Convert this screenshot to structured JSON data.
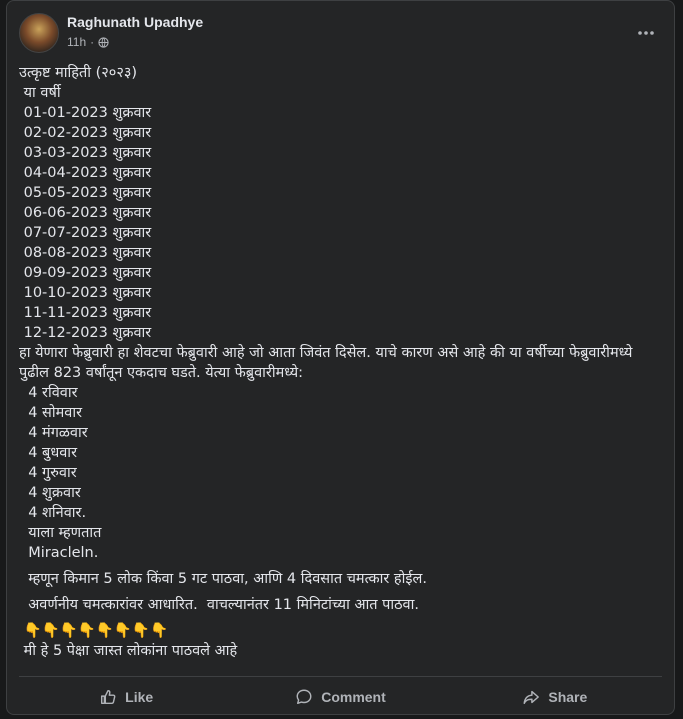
{
  "post": {
    "author": "Raghunath Upadhye",
    "time": "11h",
    "separator": "·",
    "lines": [
      "उत्कृष्ट माहिती (२०२३)",
      " या वर्षी",
      " 01-01-2023 शुक्रवार",
      " 02-02-2023 शुक्रवार",
      " 03-03-2023 शुक्रवार",
      " 04-04-2023 शुक्रवार",
      " 05-05-2023 शुक्रवार",
      " 06-06-2023 शुक्रवार",
      " 07-07-2023 शुक्रवार",
      " 08-08-2023 शुक्रवार",
      " 09-09-2023 शुक्रवार",
      " 10-10-2023 शुक्रवार",
      " 11-11-2023 शुक्रवार",
      " 12-12-2023 शुक्रवार"
    ],
    "paragraph": " हा येणारा फेब्रुवारी हा शेवटचा फेब्रुवारी आहे जो आता जिवंत दिसेल.  याचे कारण असे आहे की या वर्षीच्या फेब्रुवारीमध्ये पुढील 823 वर्षांतून एकदाच घडते.  येत्या फेब्रुवारीमध्ये:",
    "weekdays": [
      "  4 रविवार",
      "  4 सोमवार",
      "  4 मंगळवार",
      "  4 बुधवार",
      "  4 गुरुवार",
      "  4 शुक्रवार",
      "  4 शनिवार.",
      "  याला म्हणतात",
      "  Miracleln."
    ],
    "line_send": "  म्हणून किमान 5 लोक किंवा 5 गट पाठवा, आणि 4 दिवसात चमत्कार होईल.",
    "line_based": "  अवर्णनीय चमत्कारांवर आधारित.  वाचल्यानंतर 11 मिनिटांच्या आत पाठवा.",
    "emoji_row": " 👇👇👇👇👇👇👇👇",
    "last_line": " मी हे 5 पेक्षा जास्त लोकांना पाठवले आहे"
  },
  "actions": {
    "like": "Like",
    "comment": "Comment",
    "share": "Share"
  },
  "colors": {
    "background": "#18191a",
    "card": "#242526",
    "text": "#e4e6eb",
    "secondary": "#b0b3b8"
  },
  "icons": [
    "globe-icon",
    "more-options-icon",
    "like-icon",
    "comment-icon",
    "share-icon"
  ]
}
